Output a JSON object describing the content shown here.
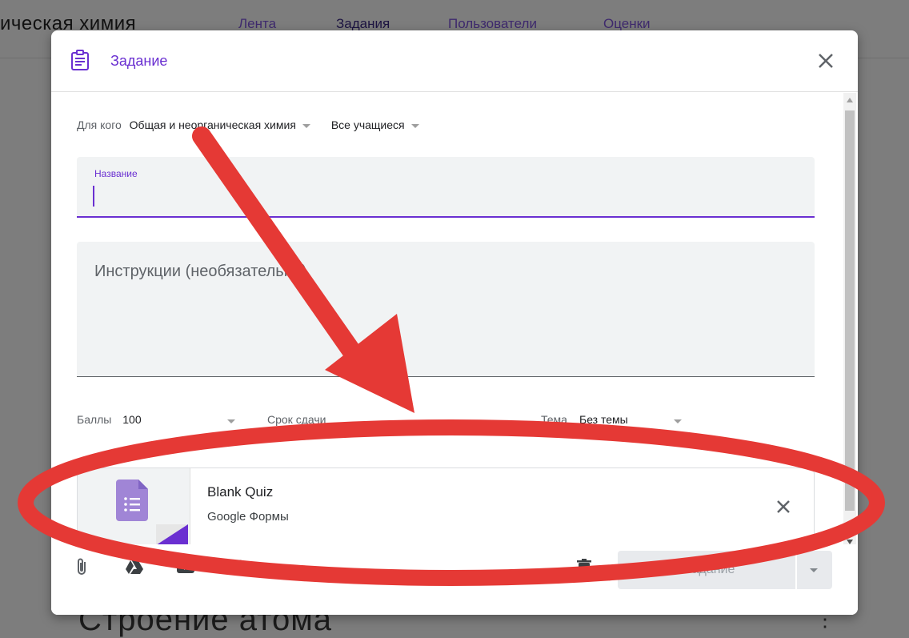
{
  "background": {
    "course_title": "ическая химия",
    "tabs": [
      "Лента",
      "Задания",
      "Пользователи",
      "Оценки"
    ],
    "bottom_title": "Строение атома"
  },
  "dialog": {
    "title": "Задание",
    "for_label": "Для кого",
    "for_class": "Общая и неорганическая химия",
    "for_students": "Все учащиеся",
    "title_field_label": "Название",
    "title_value": "",
    "instructions_placeholder": "Инструкции (необязательно)",
    "points_label": "Баллы",
    "points_value": "100",
    "due_label": "Срок сдачи",
    "topic_label": "Тема",
    "topic_value": "Без темы",
    "attachment": {
      "title": "Blank Quiz",
      "subtitle": "Google Формы"
    },
    "create_button": "Создать задание"
  },
  "colors": {
    "accent": "#6a2fd1",
    "forms": "#a085d6",
    "annotation": "#e53935"
  },
  "icons": [
    "assignment-icon",
    "close-icon",
    "paperclip-icon",
    "drive-icon",
    "youtube-icon",
    "link-icon",
    "trash-icon",
    "google-forms-icon"
  ]
}
